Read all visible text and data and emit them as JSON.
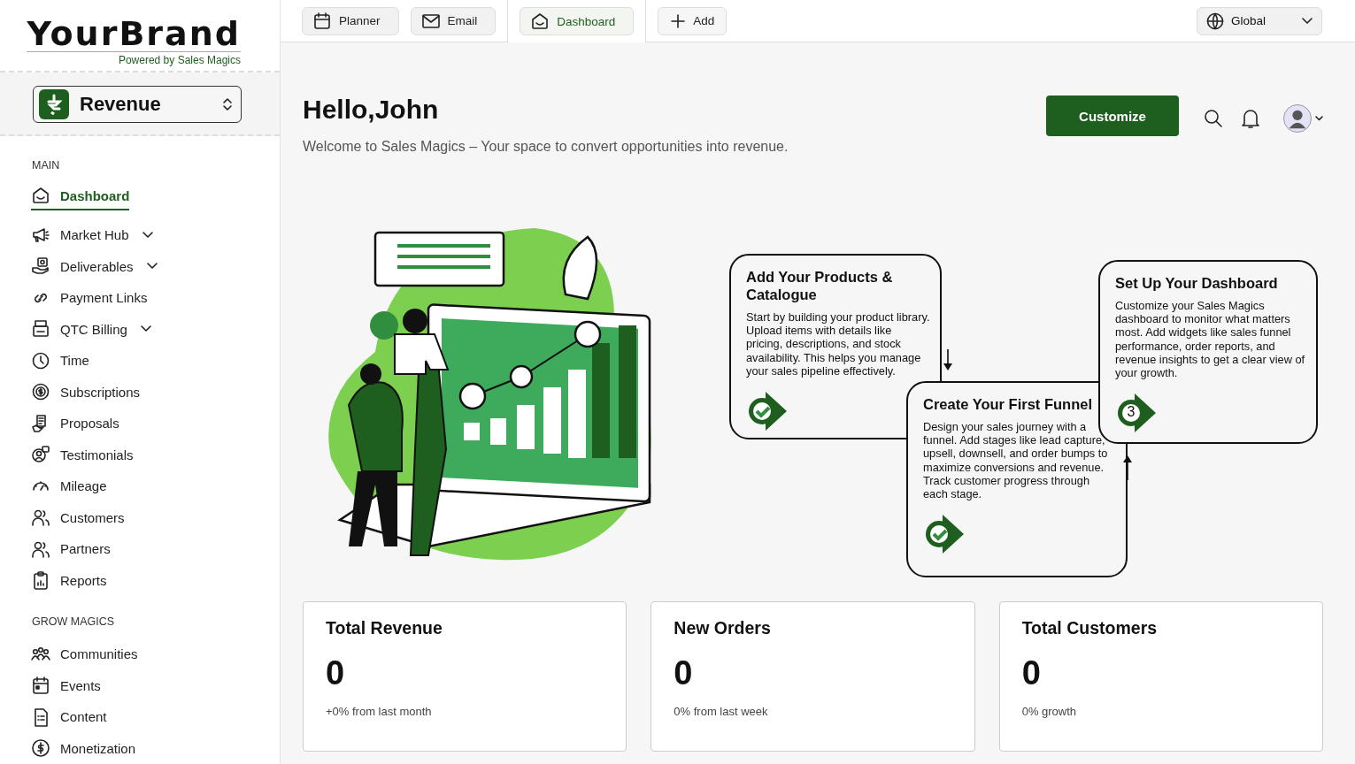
{
  "brand": {
    "name": "YourBrand",
    "tagline": "Powered by Sales Magics"
  },
  "workspace": {
    "label": "Revenue"
  },
  "sidebar": {
    "sections": [
      {
        "heading": "MAIN",
        "items": [
          {
            "label": "Dashboard",
            "selected": true,
            "kind": "link"
          },
          {
            "label": "Market Hub",
            "selected": false,
            "kind": "group"
          },
          {
            "label": "Deliverables",
            "selected": false,
            "kind": "group"
          },
          {
            "label": "Payment Links",
            "selected": false,
            "kind": "link"
          },
          {
            "label": "QTC Billing",
            "selected": false,
            "kind": "group"
          },
          {
            "label": "Time",
            "selected": false,
            "kind": "link"
          },
          {
            "label": "Subscriptions",
            "selected": false,
            "kind": "link"
          },
          {
            "label": "Proposals",
            "selected": false,
            "kind": "link"
          },
          {
            "label": "Testimonials",
            "selected": false,
            "kind": "link"
          },
          {
            "label": "Mileage",
            "selected": false,
            "kind": "link"
          },
          {
            "label": "Customers",
            "selected": false,
            "kind": "link"
          },
          {
            "label": "Partners",
            "selected": false,
            "kind": "link"
          },
          {
            "label": "Reports",
            "selected": false,
            "kind": "link"
          }
        ]
      },
      {
        "heading": "GROW MAGICS",
        "items": [
          {
            "label": "Communities",
            "selected": false,
            "kind": "link"
          },
          {
            "label": "Events",
            "selected": false,
            "kind": "link"
          },
          {
            "label": "Content",
            "selected": false,
            "kind": "link"
          },
          {
            "label": "Monetization",
            "selected": false,
            "kind": "link"
          }
        ]
      }
    ]
  },
  "tabs": [
    {
      "label": "Planner",
      "selected": false
    },
    {
      "label": "Email",
      "selected": false
    },
    {
      "label": "Dashboard",
      "selected": true
    }
  ],
  "add_button": "Add",
  "region": {
    "value": "Global"
  },
  "header": {
    "title": "Hello,John",
    "subtitle": "Welcome to Sales Magics – Your space to convert opportunities into revenue.",
    "button": "Customize"
  },
  "steps": [
    {
      "title": "Add Your Products & Catalogue",
      "text": "Start by building your product library. Upload items with details like pricing, descriptions, and stock availability. This helps you manage your sales pipeline effectively.",
      "marker": {
        "kind": "done"
      }
    },
    {
      "title": "Create Your First Funnel",
      "text": "Design your sales journey with a funnel. Add stages like lead capture, upsell, downsell, and order bumps to maximize conversions and revenue. Track customer progress through each stage.",
      "marker": {
        "kind": "done"
      }
    },
    {
      "title": "Set Up Your Dashboard",
      "text": "Customize your Sales Magics dashboard to monitor what matters most. Add widgets like sales funnel performance, order reports, and revenue insights to get a clear view of your growth.",
      "marker": {
        "kind": "number",
        "label": "3"
      }
    }
  ],
  "stats": [
    {
      "title": "Total Revenue",
      "value": "0",
      "note": "+0% from last month"
    },
    {
      "title": "New Orders",
      "value": "0",
      "note": "0% from last week"
    },
    {
      "title": "Total Customers",
      "value": "0",
      "note": "0% growth"
    }
  ]
}
